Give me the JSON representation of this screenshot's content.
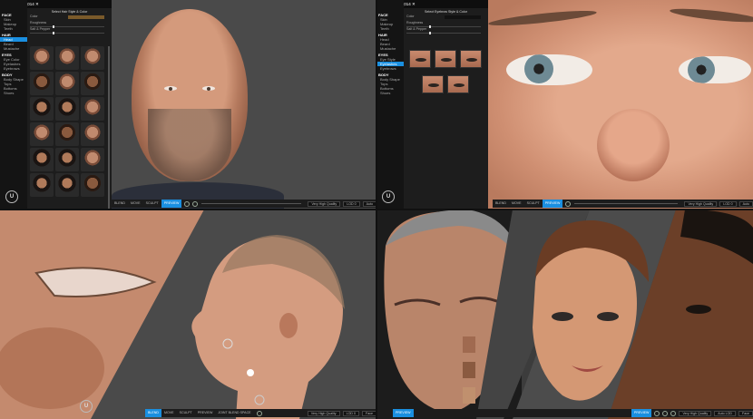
{
  "app": {
    "title": "metahuman_014"
  },
  "panel1": {
    "editor_header": "Select Hair Style & Color",
    "color_label": "Color",
    "roughness_label": "Roughness",
    "salt_pepper_label": "Salt & Pepper"
  },
  "panel2": {
    "editor_header": "Select Eyebrow Style & Color",
    "color_label": "Color",
    "roughness_label": "Roughness",
    "salt_pepper_label": "Salt & Pepper"
  },
  "sidebar": {
    "sections": [
      {
        "label": "FACE",
        "items": [
          "Skin",
          "Makeup",
          "Teeth"
        ]
      },
      {
        "label": "HAIR",
        "items": [
          "Head",
          "Beard",
          "Mustache"
        ]
      },
      {
        "label": "EYES",
        "items": [
          "Eye Color",
          "Eyelashes",
          "Eyebrows"
        ]
      },
      {
        "label": "BODY",
        "items": [
          "Body Shape",
          "Tops",
          "Bottoms",
          "Shoes"
        ]
      }
    ]
  },
  "sidebar2": {
    "sections": [
      {
        "label": "FACE",
        "items": [
          "Skin",
          "Makeup",
          "Teeth"
        ]
      },
      {
        "label": "HAIR",
        "items": [
          "Head",
          "Beard",
          "Mustache"
        ]
      },
      {
        "label": "EYES",
        "items": [
          "Eye Style",
          "Eyelashes",
          "Eyebrows"
        ]
      },
      {
        "label": "BODY",
        "items": [
          "Body Shape",
          "Tops",
          "Bottoms",
          "Shoes"
        ]
      }
    ]
  },
  "toolbar": {
    "blend": "BLEND",
    "move": "MOVE",
    "sculpt": "SCULPT",
    "preview": "PREVIEW",
    "quality": "Very High Quality",
    "lod": "LOD 0",
    "auto": "Auto",
    "face": "Face"
  },
  "toolbar3": {
    "blend": "BLEND",
    "move": "MOVE",
    "sculpt": "SCULPT",
    "preview": "PREVIEW",
    "joint_space": "JOINT BLEND SPACE",
    "quality": "Very High Quality",
    "lod": "LOD 0",
    "face": "Face"
  },
  "toolbar4": {
    "preview": "PREVIEW",
    "quality": "Very High Quality",
    "lod": "Auto LOD",
    "face": "Face"
  },
  "icons": {
    "ue_logo": "unreal-engine-logo-icon"
  }
}
